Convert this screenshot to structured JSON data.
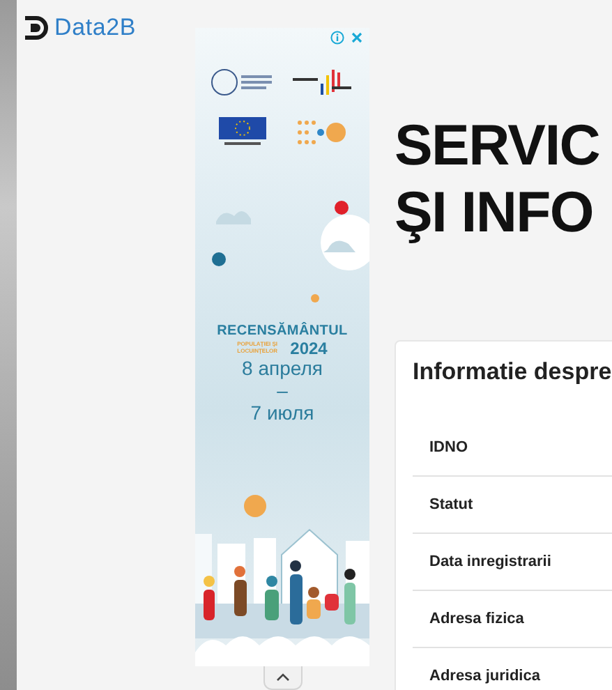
{
  "logo": {
    "text": "Data2B"
  },
  "ad": {
    "title": "RECENSĂMÂNTUL",
    "subtitle": "POPULAŢIEI ŞI LOCUINŢELOR",
    "year": "2024",
    "date_start": "8 апреля",
    "dash": "–",
    "date_end": "7 июля"
  },
  "heading": [
    "SERVIC",
    "ŞI INFO"
  ],
  "card": {
    "title": "Informatie despre",
    "rows": [
      {
        "label": "IDNO"
      },
      {
        "label": "Statut"
      },
      {
        "label": "Data inregistrarii"
      },
      {
        "label": "Adresa fizica"
      },
      {
        "label": "Adresa juridica"
      }
    ]
  }
}
